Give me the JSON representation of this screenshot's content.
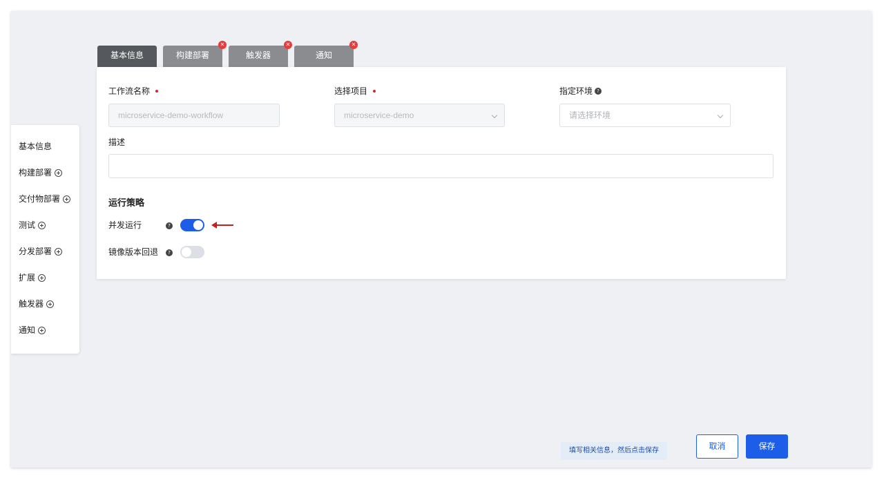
{
  "sidebar": {
    "items": [
      {
        "label": "基本信息",
        "has_add": false
      },
      {
        "label": "构建部署",
        "has_add": true
      },
      {
        "label": "交付物部署",
        "has_add": true
      },
      {
        "label": "测试",
        "has_add": true
      },
      {
        "label": "分发部署",
        "has_add": true
      },
      {
        "label": "扩展",
        "has_add": true
      },
      {
        "label": "触发器",
        "has_add": true
      },
      {
        "label": "通知",
        "has_add": true
      }
    ]
  },
  "tabs": [
    {
      "label": "基本信息",
      "active": true,
      "closable": false
    },
    {
      "label": "构建部署",
      "active": false,
      "closable": true
    },
    {
      "label": "触发器",
      "active": false,
      "closable": true
    },
    {
      "label": "通知",
      "active": false,
      "closable": true
    }
  ],
  "form": {
    "workflow_name": {
      "label": "工作流名称",
      "value": "microservice-demo-workflow",
      "required": true
    },
    "project": {
      "label": "选择项目",
      "value": "microservice-demo",
      "required": true
    },
    "environment": {
      "label": "指定环境",
      "placeholder": "请选择环境"
    },
    "description": {
      "label": "描述",
      "value": ""
    },
    "strategy": {
      "title": "运行策略",
      "concurrent": {
        "label": "并发运行",
        "enabled": true
      },
      "image_rollback": {
        "label": "镜像版本回退",
        "enabled": false
      }
    }
  },
  "footer": {
    "hint": "填写相关信息，然后点击保存",
    "cancel_label": "取消",
    "save_label": "保存"
  },
  "colors": {
    "primary": "#1d5ee8",
    "required_dot": "#d42a2a",
    "close_badge": "#ea3b3b",
    "tab_active": "#55585c",
    "tab_inactive": "#8a8c90"
  },
  "icons": {
    "add": "plus-circle-icon",
    "help": "question-circle-icon",
    "close": "close-icon",
    "select": "chevron-down-icon",
    "annotation": "arrow-left-icon"
  }
}
